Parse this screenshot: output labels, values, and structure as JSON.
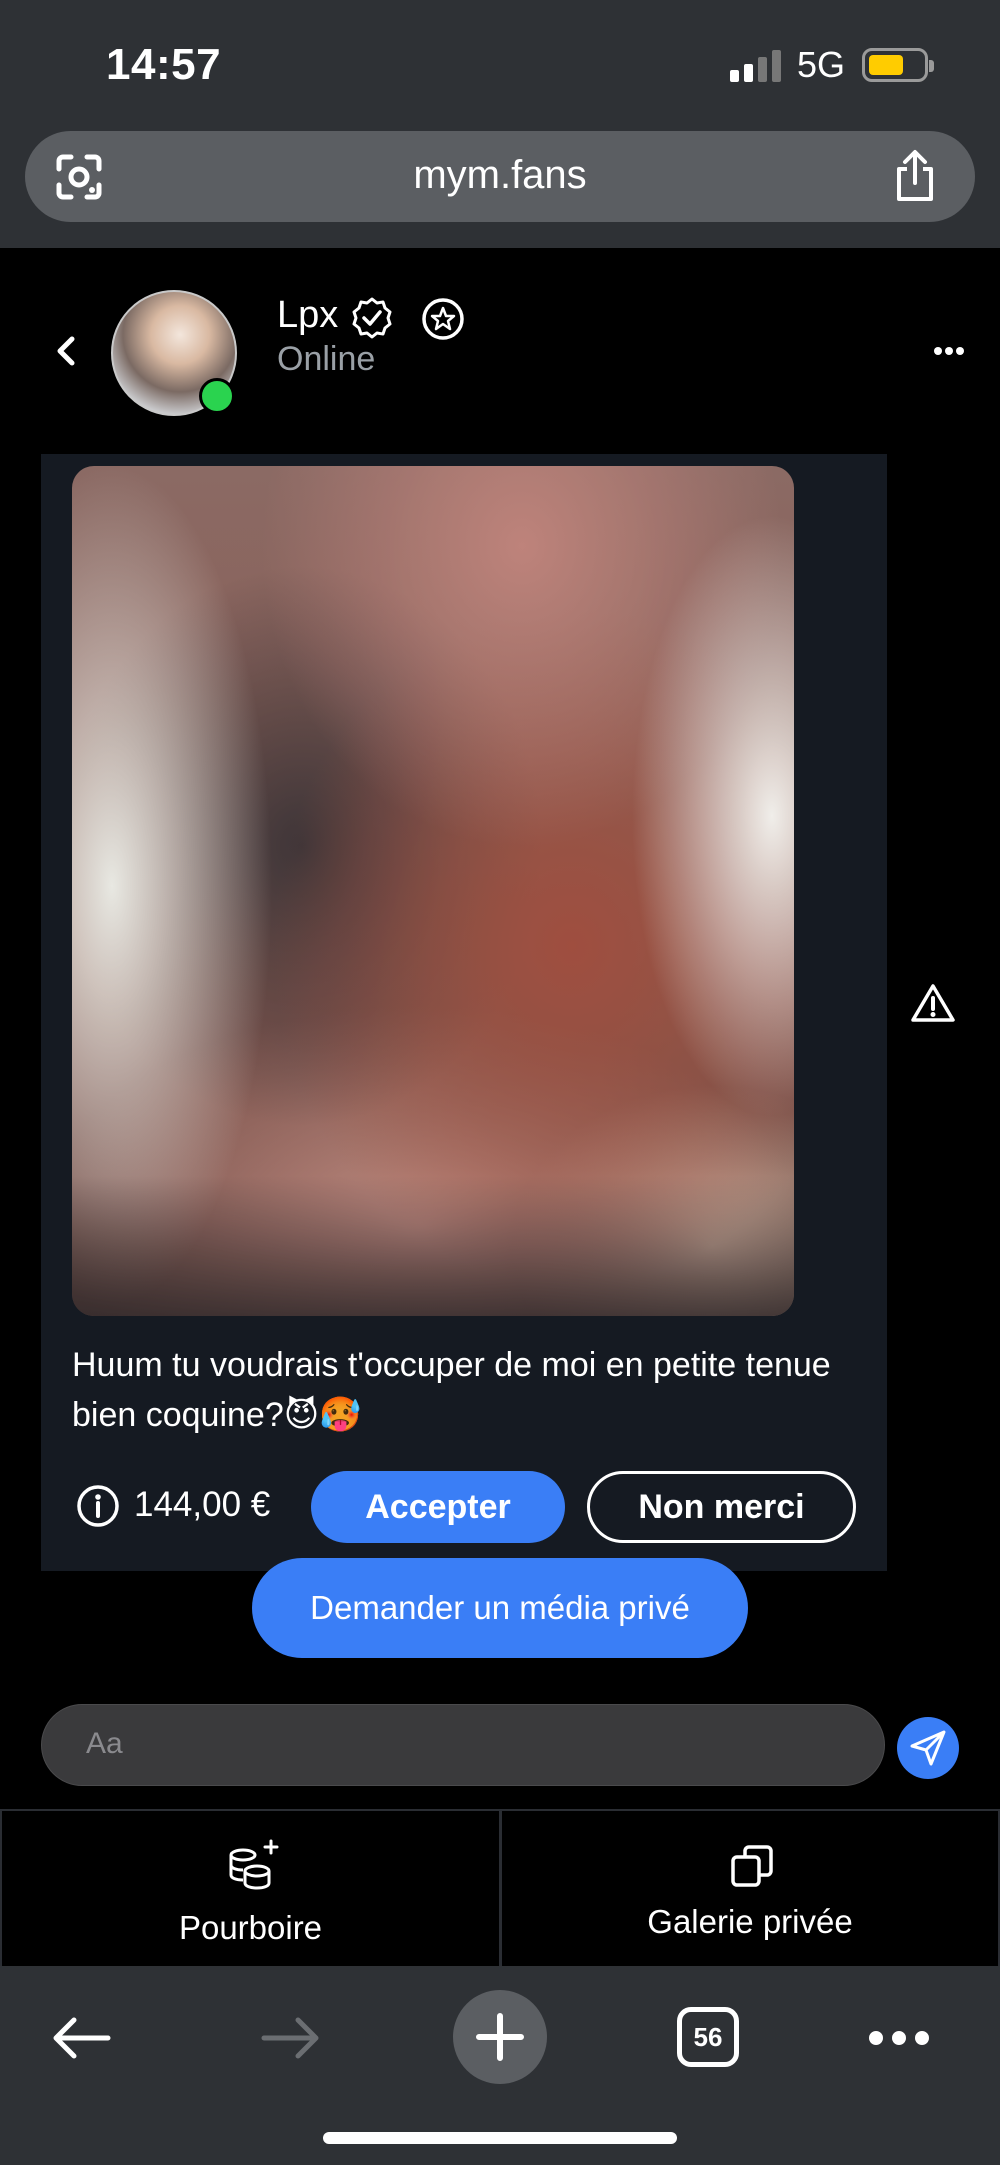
{
  "status_bar": {
    "time": "14:57",
    "network": "5G",
    "battery_color": "#ffcc00"
  },
  "browser": {
    "url": "mym.fans",
    "open_tabs": "56",
    "icons": [
      "google-lens-icon",
      "share-icon",
      "back-arrow-icon",
      "forward-arrow-icon",
      "plus-icon",
      "more-icon"
    ]
  },
  "header": {
    "name": "Lpx",
    "presence": "Online",
    "icons": [
      "back-chevron-icon",
      "verified-badge-icon",
      "star-icon",
      "more-dots-icon"
    ]
  },
  "message": {
    "text": "Huum tu voudrais t'occuper de moi en petite tenue bien coquine?😈🥵",
    "price": "144,00 €",
    "accept_label": "Accepter",
    "decline_label": "Non merci"
  },
  "request_media_label": "Demander un média privé",
  "composer": {
    "placeholder": "Aa"
  },
  "bottom_tabs": {
    "tip_label": "Pourboire",
    "gallery_label": "Galerie privée"
  },
  "colors": {
    "accent": "#3a7ef6",
    "online": "#2ad34f",
    "card_bg": "#151a22"
  }
}
